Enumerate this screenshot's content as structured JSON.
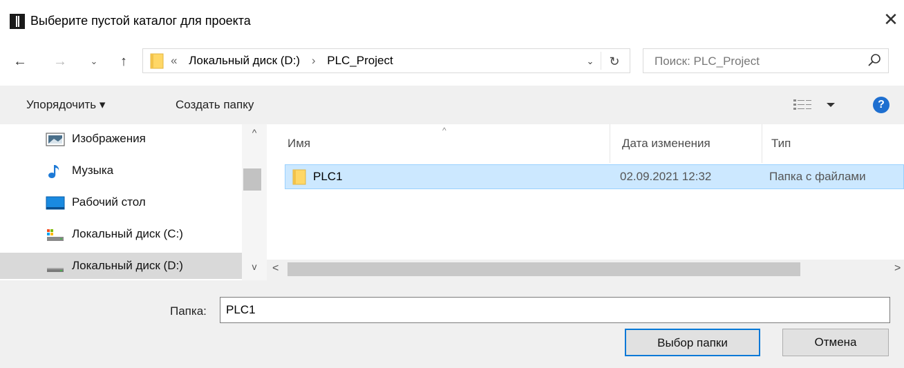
{
  "window": {
    "title": "Выберите пустой каталог для проекта",
    "close_glyph": "✕"
  },
  "nav_buttons": {
    "back": "←",
    "forward": "→",
    "recent": "⌄",
    "up": "↑"
  },
  "address": {
    "overflow": "«",
    "crumbs": [
      "Локальный диск (D:)",
      "PLC_Project"
    ],
    "separator": "›",
    "dropdown_glyph": "⌄",
    "refresh_glyph": "↻"
  },
  "search": {
    "placeholder": "Поиск: PLC_Project"
  },
  "toolbar": {
    "organize_label": "Упорядочить ▾",
    "new_folder_label": "Создать папку",
    "help_label": "?"
  },
  "nav_pane": {
    "items": [
      {
        "label": "Изображения",
        "icon": "pictures-icon"
      },
      {
        "label": "Музыка",
        "icon": "music-icon"
      },
      {
        "label": "Рабочий стол",
        "icon": "desktop-icon"
      },
      {
        "label": "Локальный диск (C:)",
        "icon": "system-drive-icon"
      },
      {
        "label": "Локальный диск (D:)",
        "icon": "drive-icon",
        "selected": true
      }
    ],
    "scroll_up": "^",
    "scroll_down": "v"
  },
  "file_list": {
    "columns": [
      "Имя",
      "Дата изменения",
      "Тип"
    ],
    "sort_indicator": "^",
    "rows": [
      {
        "name": "PLC1",
        "modified": "02.09.2021 12:32",
        "type": "Папка с файлами",
        "selected": true
      }
    ],
    "hscroll_left": "<",
    "hscroll_right": ">"
  },
  "footer": {
    "folder_label": "Папка:",
    "folder_value": "PLC1",
    "select_button": "Выбор папки",
    "cancel_button": "Отмена"
  },
  "colors": {
    "selection_bg": "#cce8ff",
    "selection_border": "#99d1ff",
    "accent": "#0078d7",
    "help_icon": "#1e6fd0",
    "folder_yellow": "#ffd766"
  }
}
